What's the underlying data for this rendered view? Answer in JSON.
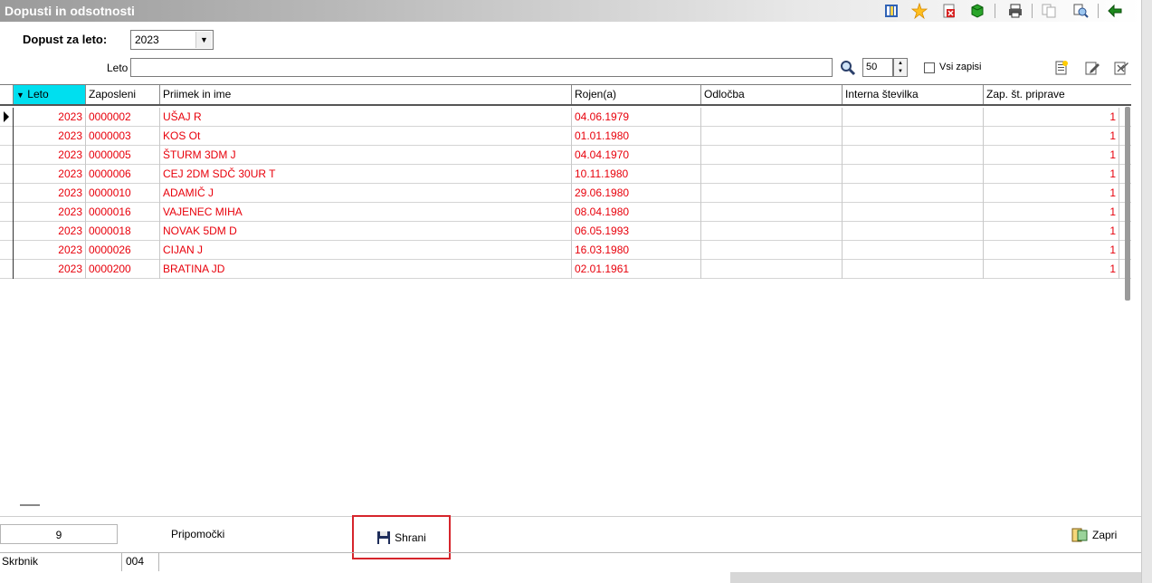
{
  "window": {
    "title": "Dopusti in odsotnosti"
  },
  "filter": {
    "label": "Dopust za leto:",
    "year": "2023",
    "leto_label": "Leto",
    "leto_value": "",
    "count": "50",
    "all_records_label": "Vsi zapisi",
    "all_records_checked": false
  },
  "grid": {
    "columns": [
      "Leto",
      "Zaposleni",
      "Priimek in ime",
      "Rojen(a)",
      "Odločba",
      "Interna številka",
      "Zap. št. priprave"
    ],
    "sort_column": "Leto",
    "rows": [
      {
        "leto": "2023",
        "zaposleni": "0000002",
        "ime": "UŠAJ R",
        "rojen": "04.06.1979",
        "odlocba": "",
        "interna": "",
        "zap": "1"
      },
      {
        "leto": "2023",
        "zaposleni": "0000003",
        "ime": "KOS Ot",
        "rojen": "01.01.1980",
        "odlocba": "",
        "interna": "",
        "zap": "1"
      },
      {
        "leto": "2023",
        "zaposleni": "0000005",
        "ime": "ŠTURM 3DM J",
        "rojen": "04.04.1970",
        "odlocba": "",
        "interna": "",
        "zap": "1"
      },
      {
        "leto": "2023",
        "zaposleni": "0000006",
        "ime": "CEJ 2DM SDČ 30UR T",
        "rojen": "10.11.1980",
        "odlocba": "",
        "interna": "",
        "zap": "1"
      },
      {
        "leto": "2023",
        "zaposleni": "0000010",
        "ime": "ADAMIČ J",
        "rojen": "29.06.1980",
        "odlocba": "",
        "interna": "",
        "zap": "1"
      },
      {
        "leto": "2023",
        "zaposleni": "0000016",
        "ime": "VAJENEC MIHA",
        "rojen": "08.04.1980",
        "odlocba": "",
        "interna": "",
        "zap": "1"
      },
      {
        "leto": "2023",
        "zaposleni": "0000018",
        "ime": "NOVAK 5DM D",
        "rojen": "06.05.1993",
        "odlocba": "",
        "interna": "",
        "zap": "1"
      },
      {
        "leto": "2023",
        "zaposleni": "0000026",
        "ime": "CIJAN J",
        "rojen": "16.03.1980",
        "odlocba": "",
        "interna": "",
        "zap": "1"
      },
      {
        "leto": "2023",
        "zaposleni": "0000200",
        "ime": "BRATINA JD",
        "rojen": "02.01.1961",
        "odlocba": "",
        "interna": "",
        "zap": "1"
      }
    ]
  },
  "footer": {
    "record_count": "9",
    "pripomocki_label": "Pripomočki",
    "save_label": "Shrani",
    "close_label": "Zapri"
  },
  "status": {
    "user": "Skrbnik",
    "code": "004"
  },
  "colors": {
    "row_text": "#e8000b",
    "sort_header": "#00dfef",
    "highlight_box": "#d6252c"
  },
  "toolbar_icons": [
    "columns-icon",
    "star-icon",
    "delete-icon",
    "cube-icon",
    "printer-icon",
    "copy-icon",
    "search-docs-icon",
    "exit-icon"
  ],
  "row_icons": [
    "new-record-icon",
    "edit-record-icon",
    "edit-multi-icon"
  ]
}
